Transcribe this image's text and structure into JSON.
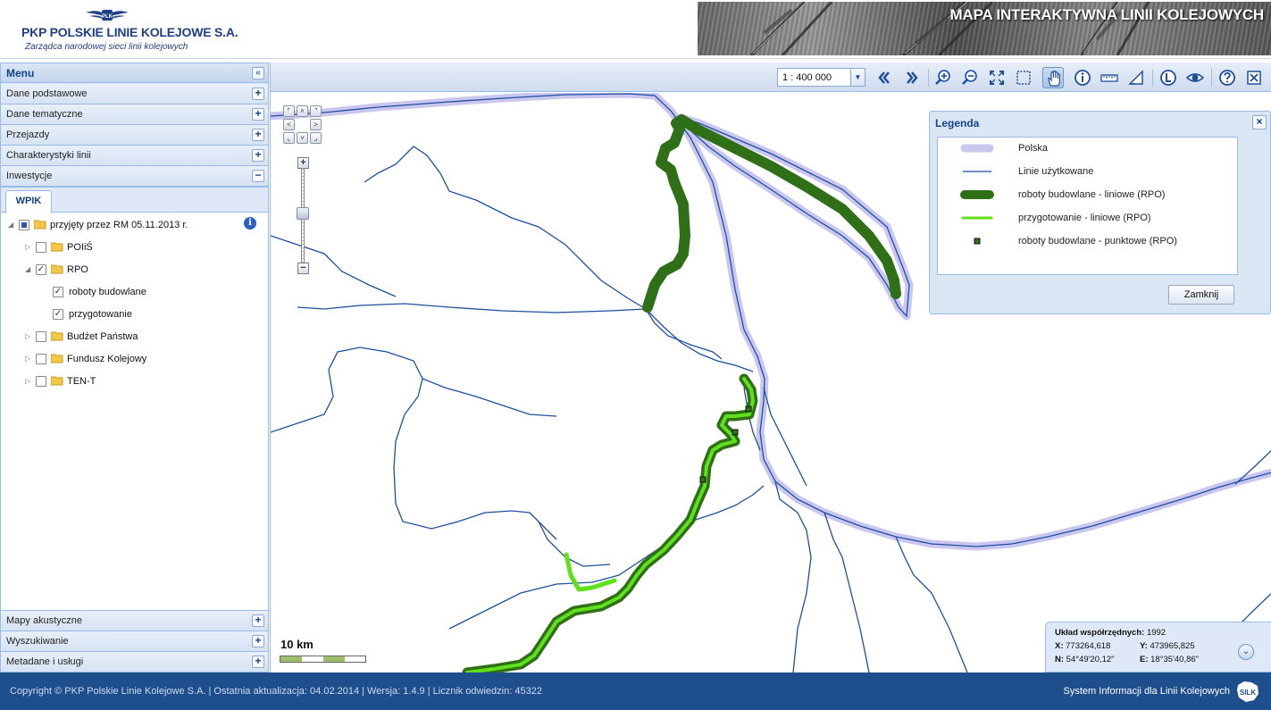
{
  "header": {
    "logo_badge": "PLK",
    "logo_title": "PKP POLSKIE LINIE KOLEJOWE S.A.",
    "logo_subtitle": "Zarządca narodowej sieci linii kolejowych",
    "banner_title": "MAPA INTERAKTYWNA LINII KOLEJOWYCH"
  },
  "sidebar": {
    "title": "Menu",
    "collapse_icon": "double-chevron-left",
    "top_items": [
      {
        "label": "Dane podstawowe",
        "state": "+"
      },
      {
        "label": "Dane tematyczne",
        "state": "+"
      },
      {
        "label": "Przejazdy",
        "state": "+"
      },
      {
        "label": "Charakterystyki linii",
        "state": "+"
      },
      {
        "label": "Inwestycje",
        "state": "−"
      }
    ],
    "tab": "WPIK",
    "tree": {
      "root": {
        "label": "przyjęty przez RM 05.11.2013 r.",
        "checked": "partial"
      },
      "children": [
        {
          "label": "POIiŚ",
          "checked": false,
          "expanded": false
        },
        {
          "label": "RPO",
          "checked": true,
          "expanded": true,
          "children": [
            {
              "label": "roboty budowlane",
              "checked": true
            },
            {
              "label": "przygotowanie",
              "checked": true
            }
          ]
        },
        {
          "label": "Budżet Państwa",
          "checked": false,
          "expanded": false
        },
        {
          "label": "Fundusz Kolejowy",
          "checked": false,
          "expanded": false
        },
        {
          "label": "TEN-T",
          "checked": false,
          "expanded": false
        }
      ]
    },
    "bottom_items": [
      {
        "label": "Mapy akustyczne",
        "state": "+"
      },
      {
        "label": "Wyszukiwanie",
        "state": "+"
      },
      {
        "label": "Metadane i usługi",
        "state": "+"
      }
    ]
  },
  "toolbar": {
    "scale_value": "1 : 400 000",
    "buttons": [
      "previous-extent-icon",
      "next-extent-icon",
      "zoom-in-icon",
      "zoom-out-icon",
      "full-extent-icon",
      "select-box-icon",
      "pan-hand-icon",
      "info-icon",
      "measure-length-icon",
      "measure-area-icon",
      "layers-L-icon",
      "visibility-eye-icon",
      "help-icon",
      "close-x-icon"
    ],
    "active_button": "pan-hand-icon"
  },
  "map": {
    "scale_label": "10 km",
    "colors": {
      "polska": "#c9c6f0",
      "linie": "#1f4f9e",
      "roboty_liniowe": "#2e6f17",
      "przygotowanie": "#5fe21b",
      "roboty_punktowe": "#2e6f17"
    }
  },
  "legend": {
    "title": "Legenda",
    "items": [
      {
        "label": "Polska",
        "symbol": "polska"
      },
      {
        "label": "Linie użytkowane",
        "symbol": "linie"
      },
      {
        "label": "roboty budowlane - liniowe (RPO)",
        "symbol": "roboty_liniowe"
      },
      {
        "label": "przygotowanie - liniowe (RPO)",
        "symbol": "przygotowanie"
      },
      {
        "label": "roboty budowlane - punktowe (RPO)",
        "symbol": "roboty_punktowe"
      }
    ],
    "close_button": "Zamknij"
  },
  "coords": {
    "system_label": "Układ współrzędnych:",
    "system_value": "1992",
    "x_label": "X:",
    "x_value": "773264,618",
    "y_label": "Y:",
    "y_value": "473965,825",
    "n_label": "N:",
    "n_value": "54°49'20,12\"",
    "e_label": "E:",
    "e_value": "18°35'40,86\""
  },
  "footer": {
    "left": "Copyright © PKP Polskie Linie Kolejowe S.A. | Ostatnia aktualizacja: 04.02.2014 | Wersja: 1.4.9 | Licznik odwiedzin: 45322",
    "right": "System Informacji dla Linii Kolejowych",
    "logo_text": "SILK"
  }
}
